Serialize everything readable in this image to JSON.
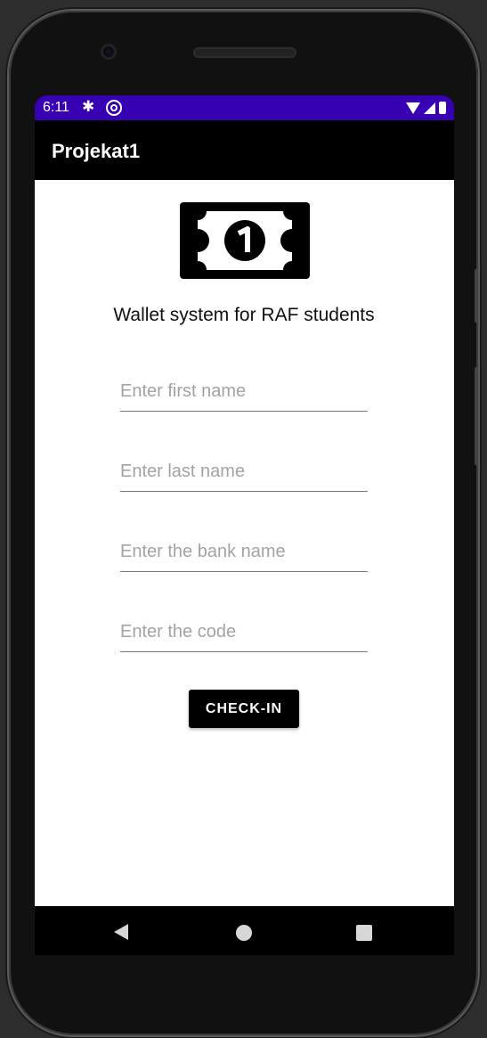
{
  "status_bar": {
    "time": "6:11",
    "background": "#3700b3"
  },
  "app_bar": {
    "title": "Projekat1"
  },
  "main": {
    "subtitle": "Wallet system for RAF students",
    "fields": {
      "first_name": {
        "placeholder": "Enter first name",
        "value": ""
      },
      "last_name": {
        "placeholder": "Enter last name",
        "value": ""
      },
      "bank_name": {
        "placeholder": "Enter the bank name",
        "value": ""
      },
      "code": {
        "placeholder": "Enter the code",
        "value": ""
      }
    },
    "checkin_label": "CHECK-IN"
  },
  "icons": {
    "banknote": "money-icon",
    "settings": "gear-icon",
    "dnd": "do-not-disturb-icon",
    "wifi": "wifi-icon",
    "signal": "signal-icon",
    "battery": "battery-icon"
  },
  "colors": {
    "accent": "#3700b3",
    "button": "#000000",
    "content_bg": "#ffffff"
  }
}
